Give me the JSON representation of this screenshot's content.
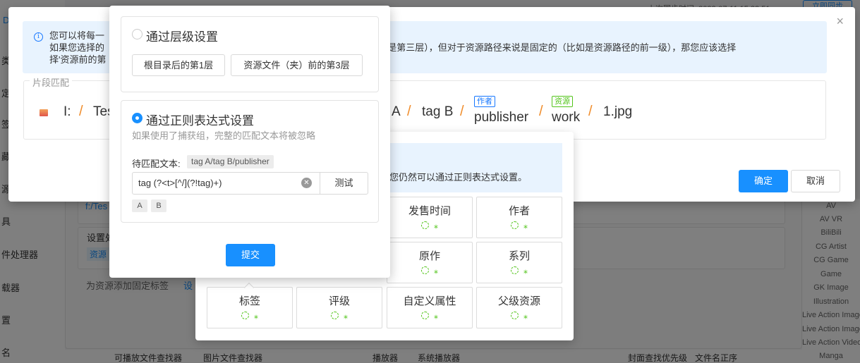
{
  "background": {
    "nav_items": [
      "类",
      "定",
      "签",
      "藏",
      "源",
      "具",
      "件处理器",
      "载器",
      "置",
      "名"
    ],
    "top_left_label": "D 匹",
    "sync_time": "上次同步时间: 2022-07-11 15:22:51",
    "sync_button": "立即同步",
    "path_row": "f:/Tes",
    "settings_row_label": "设置处",
    "settings_row_chip": "资源",
    "fixed_tag_label": "为资源添加固定标签",
    "fixed_tag_link": "设",
    "right_tags": [
      "AV",
      "AV VR",
      "BiliBili",
      "CG Artist",
      "CG Game",
      "Game",
      "GK Image",
      "Illustration",
      "Live Action Image",
      "Live Action Image Anim",
      "Live Action Video",
      "Manga"
    ],
    "bottom_bar": [
      "可播放文件查找器",
      "图片文件查找器",
      "播放器",
      "系统播放器",
      "封面查找优先级",
      "文件名正序"
    ]
  },
  "modal": {
    "info_line1": "您可以将每一级目录的名称设置为资源的属性，如果您选择的层级是固定的，可以通过层级设置；如果层级不固定，可能是第二层也可能是第三层），但对于资源路径来说是固定的（比如是资源路径的前一级），那您应该选",
    "info_line2_start": "如果您选择的",
    "info_line2_end": "也可能是第三层），但对于资源路径来说是固定的（比如是资源路径的前一级），那您应该选择",
    "info_line3": "择'资源前的第",
    "fragment_legend": "片段匹配",
    "segments": [
      "I:",
      "Tes",
      "A",
      "tag B",
      "publisher",
      "work",
      "1.jpg"
    ],
    "chips": {
      "publisher": "作者",
      "work": "资源"
    },
    "confirm": "确定",
    "cancel": "取消",
    "close": "×"
  },
  "property_grid": {
    "tip_text": "您仍然可以通过正则表达式设置。",
    "cells": [
      "发售时间",
      "作者",
      "原作",
      "系列",
      "标签",
      "评级",
      "自定义属性",
      "父级资源"
    ]
  },
  "settings_popover": {
    "level_option": {
      "title": "通过层级设置",
      "buttons": [
        "根目录后的第1层",
        "资源文件（夹）前的第3层"
      ]
    },
    "regex_option": {
      "title": "通过正则表达式设置",
      "hint": "如果使用了捕获组，完整的匹配文本将被忽略",
      "match_label": "待匹配文本:",
      "match_text": "tag A/tag B/publisher",
      "regex_value": "tag (?<t>[^/](?!tag)+)",
      "test_button": "测试",
      "groups": [
        "A",
        "B"
      ]
    },
    "submit": "提交"
  },
  "colors": {
    "primary": "#1890ff",
    "accent_orange": "#f08c2a",
    "success": "#52c41a"
  }
}
